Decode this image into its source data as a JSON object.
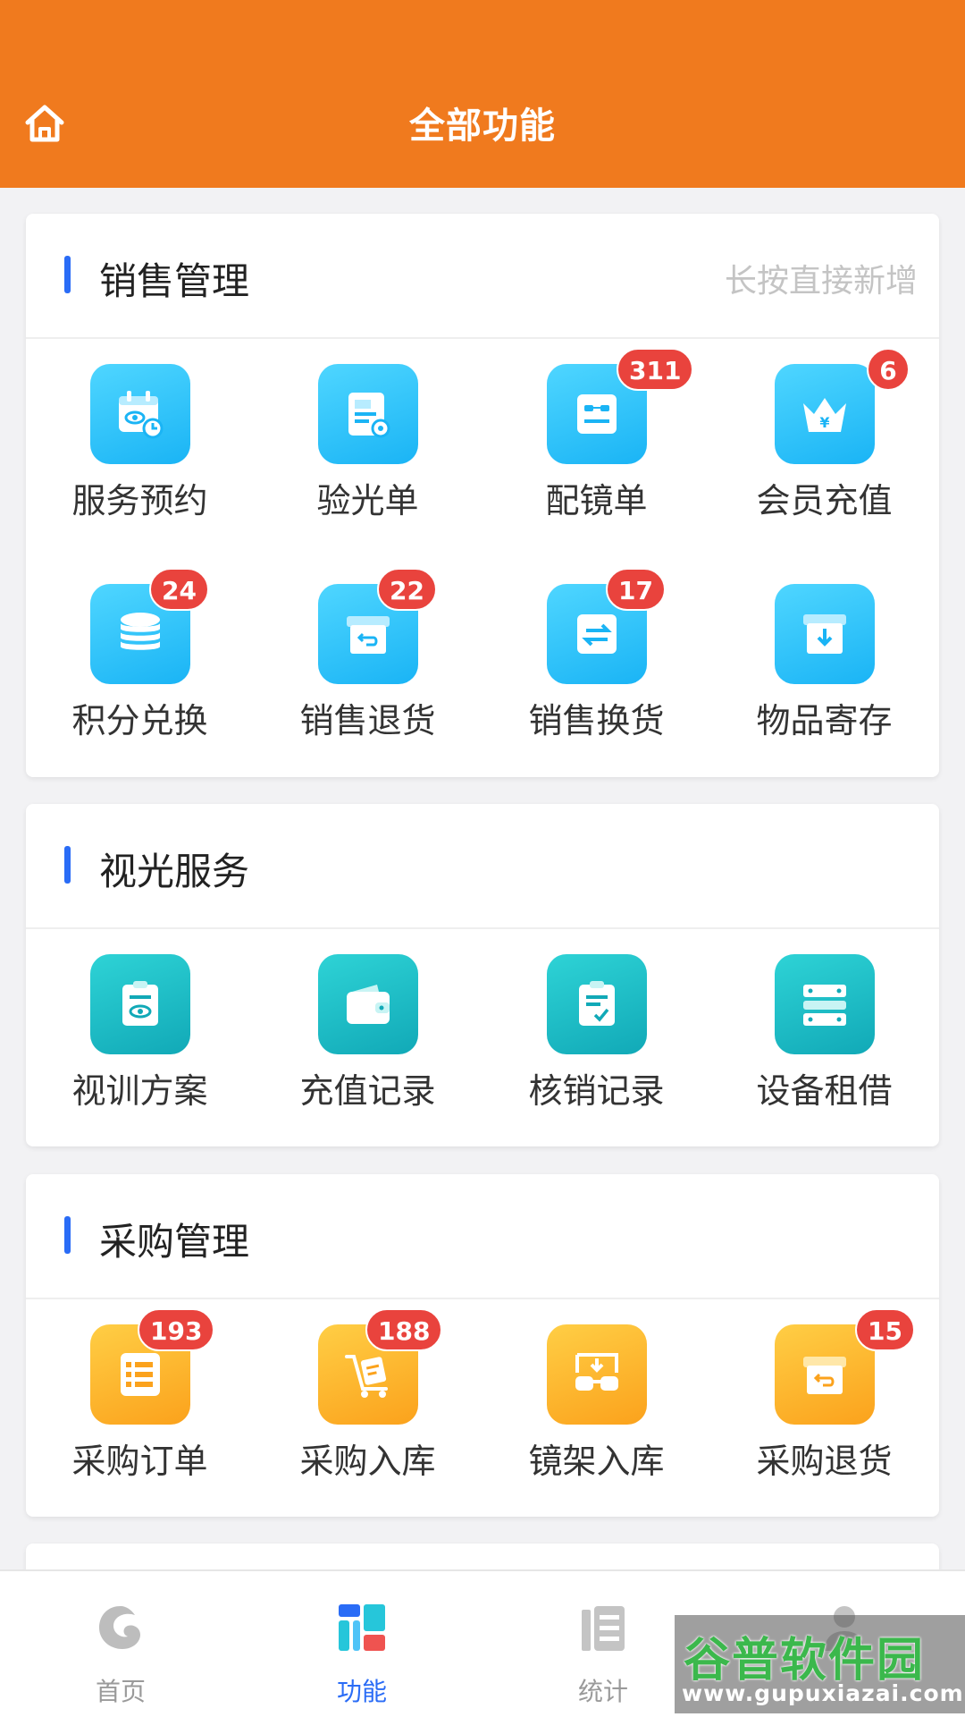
{
  "header": {
    "title": "全部功能",
    "home_icon": "home-icon"
  },
  "sections": [
    {
      "title": "销售管理",
      "hint": "长按直接新增",
      "items": [
        {
          "label": "服务预约",
          "icon": "calendar-eye-icon",
          "badge": ""
        },
        {
          "label": "验光单",
          "icon": "document-search-icon",
          "badge": ""
        },
        {
          "label": "配镜单",
          "icon": "glasses-order-icon",
          "badge": "311"
        },
        {
          "label": "会员充值",
          "icon": "crown-yen-icon",
          "badge": "6"
        },
        {
          "label": "积分兑换",
          "icon": "coins-stack-icon",
          "badge": "24"
        },
        {
          "label": "销售退货",
          "icon": "box-return-icon",
          "badge": "22"
        },
        {
          "label": "销售换货",
          "icon": "exchange-arrows-icon",
          "badge": "17"
        },
        {
          "label": "物品寄存",
          "icon": "box-download-icon",
          "badge": ""
        }
      ]
    },
    {
      "title": "视光服务",
      "hint": "",
      "items": [
        {
          "label": "视训方案",
          "icon": "clipboard-eye-icon",
          "badge": ""
        },
        {
          "label": "充值记录",
          "icon": "wallet-icon",
          "badge": ""
        },
        {
          "label": "核销记录",
          "icon": "clipboard-check-icon",
          "badge": ""
        },
        {
          "label": "设备租借",
          "icon": "server-rack-icon",
          "badge": ""
        }
      ]
    },
    {
      "title": "采购管理",
      "hint": "",
      "items": [
        {
          "label": "采购订单",
          "icon": "order-list-icon",
          "badge": "193"
        },
        {
          "label": "采购入库",
          "icon": "hand-truck-icon",
          "badge": "188"
        },
        {
          "label": "镜架入库",
          "icon": "glasses-in-icon",
          "badge": ""
        },
        {
          "label": "采购退货",
          "icon": "box-return-icon",
          "badge": "15"
        }
      ]
    }
  ],
  "tabbar": [
    {
      "label": "首页",
      "icon": "home-swirl-icon",
      "active": false
    },
    {
      "label": "功能",
      "icon": "function-grid-icon",
      "active": true
    },
    {
      "label": "统计",
      "icon": "statistics-icon",
      "active": false
    },
    {
      "label": "",
      "icon": "profile-icon",
      "active": false
    }
  ],
  "watermark": {
    "main": "谷普软件园",
    "url": "www.gupuxiazai.com"
  },
  "colors": {
    "header": "#f07a1e",
    "accent_blue": "#2a6cf6",
    "badge": "#e9433d"
  }
}
